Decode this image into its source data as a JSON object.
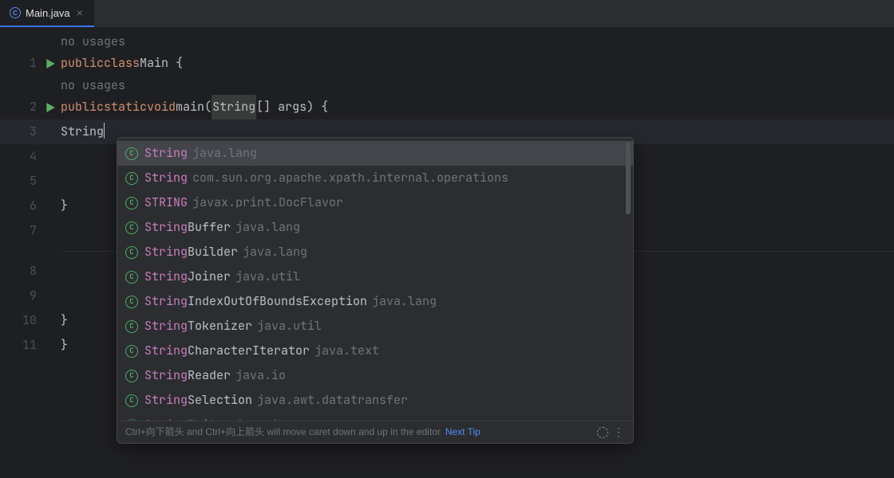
{
  "tab": {
    "title": "Main.java"
  },
  "gutter": {
    "line_numbers": [
      "1",
      "2",
      "3",
      "4",
      "5",
      "6",
      "7",
      "",
      "8",
      "9",
      "10",
      "11"
    ]
  },
  "code": {
    "no_usages": "no usages",
    "line1": {
      "public": "public",
      "class": "class",
      "name": "Main",
      "brace": " {"
    },
    "line2": {
      "public": "public",
      "static": "static",
      "void": "void",
      "main": "main",
      "lp": "(",
      "string": "String",
      "brackets": "[]",
      "args": " args",
      "rp": ")",
      "brace": " {"
    },
    "line3": {
      "typed": "String"
    },
    "closebrace": "}"
  },
  "autocomplete": {
    "items": [
      {
        "match": "String",
        "rest": "",
        "pkg": "java.lang",
        "selected": true
      },
      {
        "match": "String",
        "rest": "",
        "pkg": "com.sun.org.apache.xpath.internal.operations"
      },
      {
        "match": "STRING",
        "rest": "",
        "pkg": "javax.print.DocFlavor"
      },
      {
        "match": "String",
        "rest": "Buffer",
        "pkg": "java.lang"
      },
      {
        "match": "String",
        "rest": "Builder",
        "pkg": "java.lang"
      },
      {
        "match": "String",
        "rest": "Joiner",
        "pkg": "java.util"
      },
      {
        "match": "String",
        "rest": "IndexOutOfBoundsException",
        "pkg": "java.lang"
      },
      {
        "match": "String",
        "rest": "Tokenizer",
        "pkg": "java.util"
      },
      {
        "match": "String",
        "rest": "CharacterIterator",
        "pkg": "java.text"
      },
      {
        "match": "String",
        "rest": "Reader",
        "pkg": "java.io"
      },
      {
        "match": "String",
        "rest": "Selection",
        "pkg": "java.awt.datatransfer"
      },
      {
        "match": "String",
        "rest": "Writer",
        "pkg": "java.io"
      }
    ]
  },
  "footer": {
    "hint": "Ctrl+向下箭头 and Ctrl+向上箭头 will move caret down and up in the editor",
    "next_tip": "Next Tip"
  }
}
